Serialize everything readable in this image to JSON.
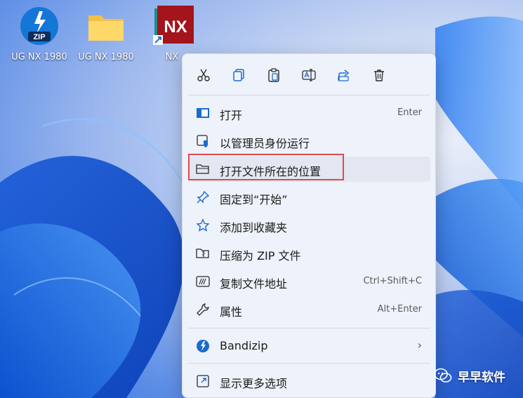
{
  "desktop": {
    "icons": [
      {
        "label": "UG NX 1980",
        "icon": "zip-archive-icon",
        "badge": "ZIP"
      },
      {
        "label": "UG NX 1980",
        "icon": "folder-icon"
      },
      {
        "label": "NX",
        "icon": "nx-app-shortcut-icon",
        "badge": "NX"
      }
    ]
  },
  "context_menu": {
    "quick_actions": [
      {
        "name": "cut",
        "icon": "scissors-icon"
      },
      {
        "name": "copy",
        "icon": "copy-icon"
      },
      {
        "name": "paste",
        "icon": "clipboard-icon"
      },
      {
        "name": "rename",
        "icon": "rename-icon"
      },
      {
        "name": "share",
        "icon": "share-icon"
      },
      {
        "name": "delete",
        "icon": "trash-icon"
      }
    ],
    "items": [
      {
        "label": "打开",
        "shortcut": "Enter",
        "icon": "open-window-icon"
      },
      {
        "label": "以管理员身份运行",
        "shortcut": "",
        "icon": "admin-shield-icon"
      },
      {
        "label": "打开文件所在的位置",
        "shortcut": "",
        "icon": "folder-open-icon"
      },
      {
        "label": "固定到“开始”",
        "shortcut": "",
        "icon": "pin-icon"
      },
      {
        "label": "添加到收藏夹",
        "shortcut": "",
        "icon": "star-icon"
      },
      {
        "label": "压缩为 ZIP 文件",
        "shortcut": "",
        "icon": "zip-folder-icon"
      },
      {
        "label": "复制文件地址",
        "shortcut": "Ctrl+Shift+C",
        "icon": "copy-path-icon"
      },
      {
        "label": "属性",
        "shortcut": "Alt+Enter",
        "icon": "wrench-icon"
      },
      {
        "label": "Bandizip",
        "shortcut": "",
        "icon": "bandizip-icon",
        "submenu": true
      },
      {
        "label": "显示更多选项",
        "shortcut": "",
        "icon": "more-options-icon"
      }
    ],
    "highlighted_item": "打开文件所在的位置",
    "hovered_item": "打开文件所在的位置"
  },
  "watermark": {
    "text": "早早软件",
    "icon": "wechat-icon"
  },
  "colors": {
    "accent": "#0067c0",
    "highlight_border": "#e0484c",
    "menu_background": "#eef2fa",
    "nx_red": "#a3141c",
    "nx_teal": "#1f8e8a"
  }
}
